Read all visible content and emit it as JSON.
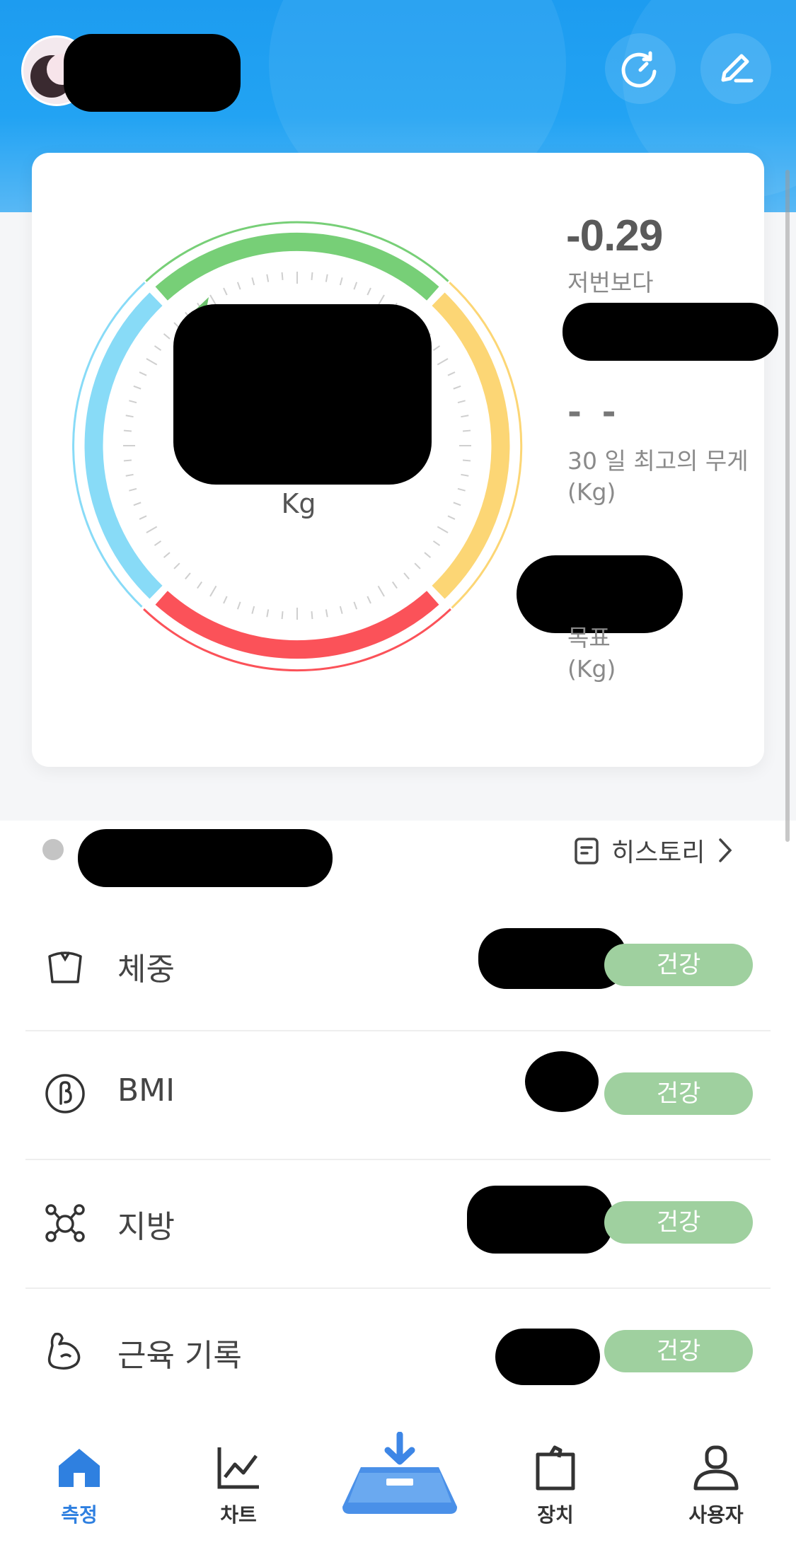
{
  "header": {
    "user_name": "",
    "refresh_icon": "refresh-icon",
    "edit_icon": "edit-pencil-icon"
  },
  "gauge": {
    "weight_value": "",
    "unit": "Kg",
    "colors": {
      "blue": "#88dbf7",
      "green": "#77cf77",
      "yellow": "#fcd675",
      "red": "#fb5259"
    }
  },
  "summary": {
    "change_value": "-0.29",
    "change_label": "저번보다",
    "best_value": "- -",
    "best_label_line1": "30 일 최고의 무게",
    "best_label_line2": "(Kg)",
    "goal_label_line1": "목표",
    "goal_label_line2": "(Kg)"
  },
  "meta": {
    "history_label": "히스토리"
  },
  "metrics": [
    {
      "label": "체중",
      "status": "건강",
      "icon": "weight-bag-icon"
    },
    {
      "label": "BMI",
      "status": "건강",
      "icon": "bmi-icon"
    },
    {
      "label": "지방",
      "status": "건강",
      "icon": "fat-molecule-icon"
    },
    {
      "label": "근육 기록",
      "status": "건강",
      "icon": "muscle-arm-icon"
    }
  ],
  "tabbar": {
    "tabs": [
      {
        "label": "측정",
        "icon": "home-icon",
        "active": true
      },
      {
        "label": "차트",
        "icon": "chart-icon",
        "active": false
      },
      {
        "label": "",
        "icon": "scale-download-icon",
        "active": false
      },
      {
        "label": "장치",
        "icon": "device-bag-icon",
        "active": false
      },
      {
        "label": "사용자",
        "icon": "user-icon",
        "active": false
      }
    ]
  },
  "accent_color": "#2f80e0"
}
